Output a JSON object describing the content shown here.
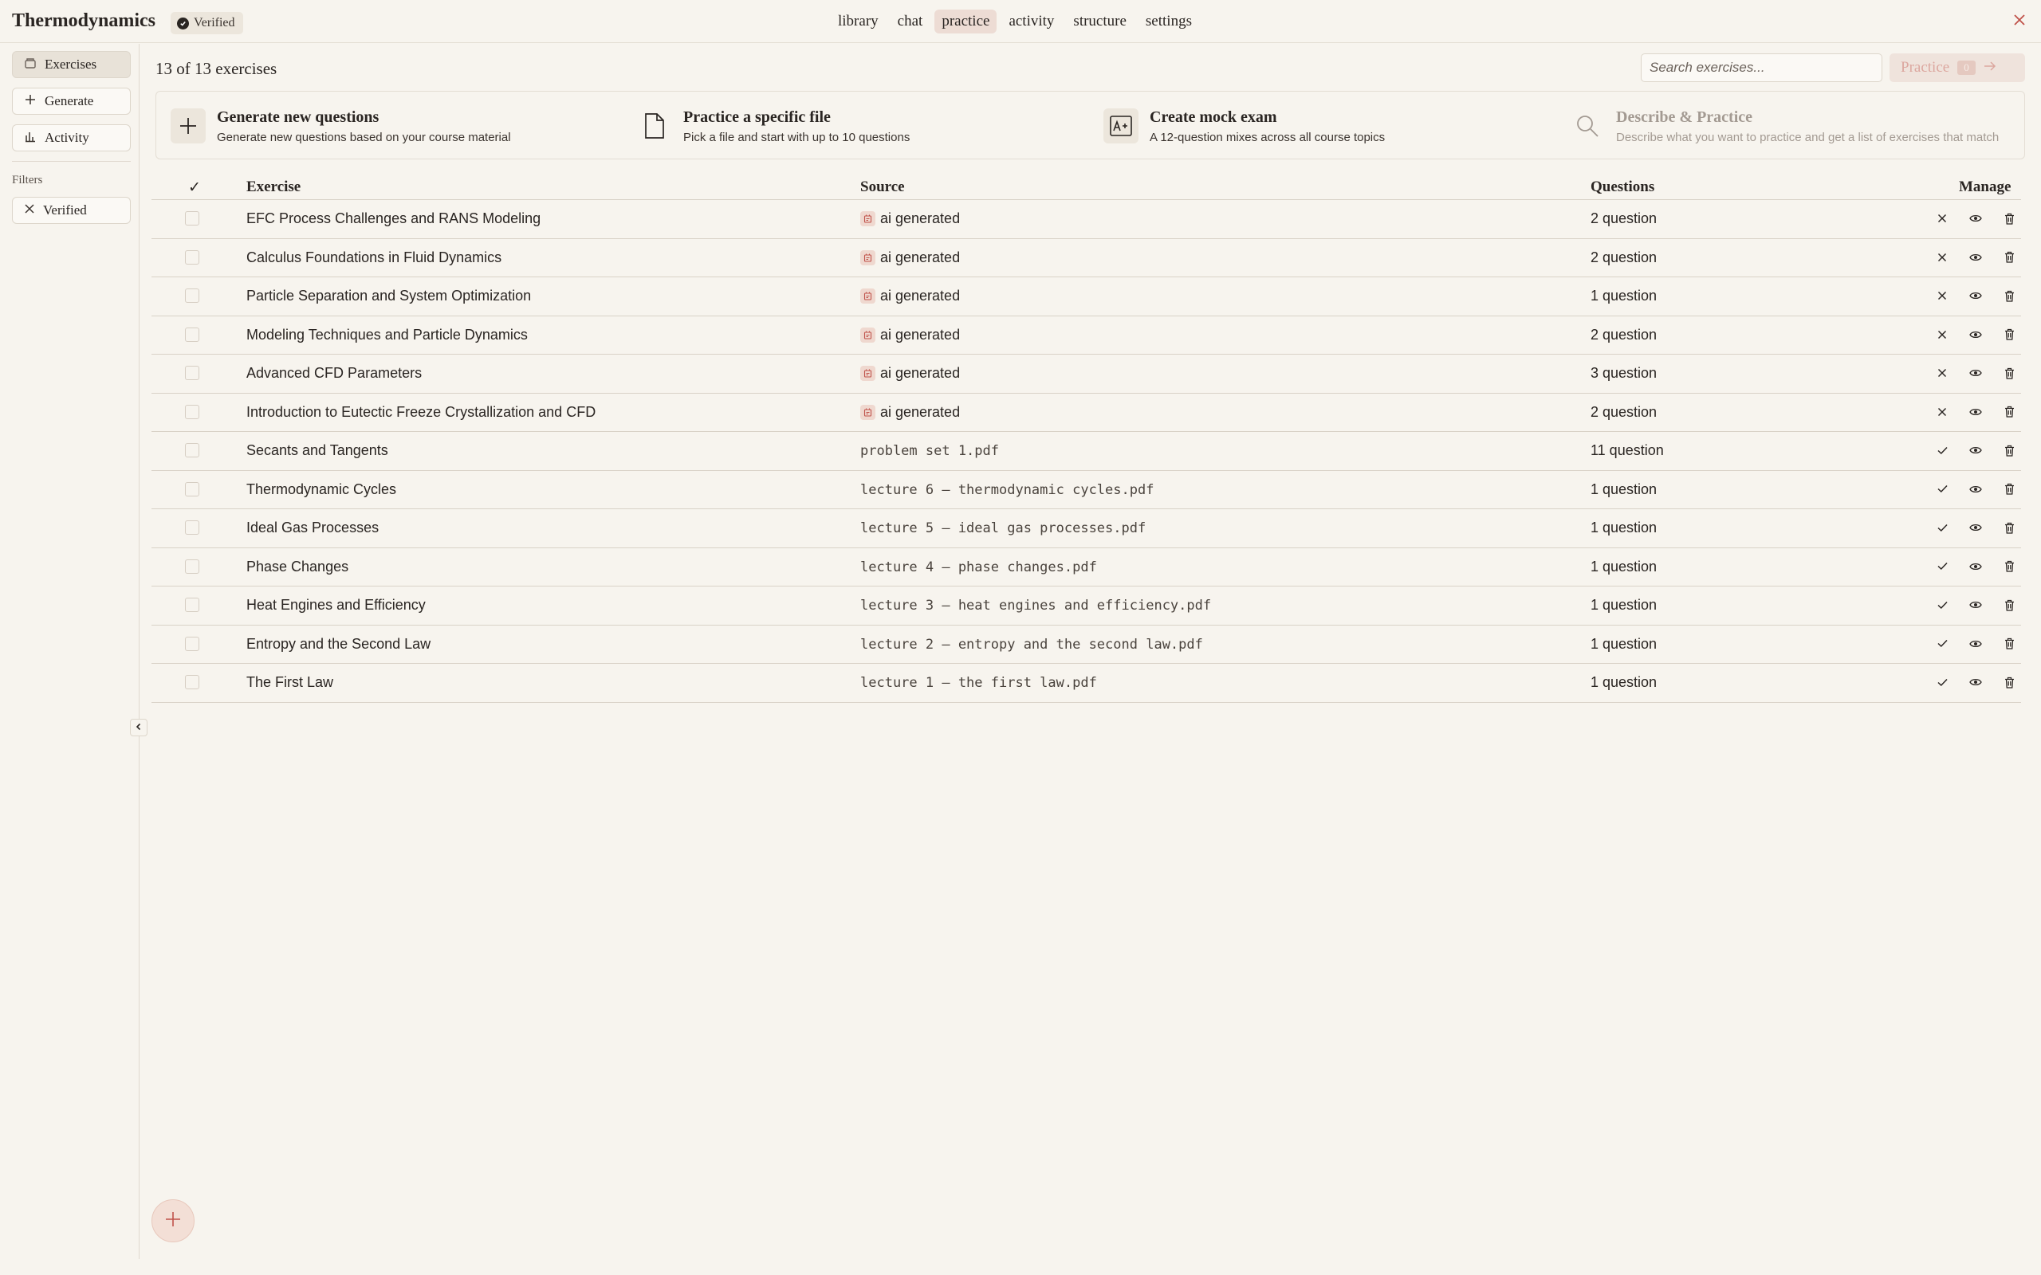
{
  "app": {
    "title": "Thermodynamics",
    "badge": "Verified"
  },
  "nav": {
    "tabs": [
      {
        "label": "library"
      },
      {
        "label": "chat"
      },
      {
        "label": "practice",
        "active": true
      },
      {
        "label": "activity"
      },
      {
        "label": "structure"
      },
      {
        "label": "settings"
      }
    ]
  },
  "sidebar": {
    "items": [
      {
        "label": "Exercises",
        "icon": "box-icon",
        "active": true
      },
      {
        "label": "Generate",
        "icon": "plus-icon"
      },
      {
        "label": "Activity",
        "icon": "bar-chart-icon"
      }
    ],
    "filters_label": "Filters",
    "filter_chip": "Verified"
  },
  "main": {
    "count_text": "13 of 13 exercises",
    "search_placeholder": "Search exercises...",
    "practice_label": "Practice",
    "practice_count": "0"
  },
  "actions": [
    {
      "title": "Generate new questions",
      "desc": "Generate new questions based on your course material",
      "icon": "plus-icon"
    },
    {
      "title": "Practice a specific file",
      "desc": "Pick a file and start with up to 10 questions",
      "icon": "file-icon"
    },
    {
      "title": "Create mock exam",
      "desc": "A 12-question mixes across all course topics",
      "icon": "exam-icon"
    },
    {
      "title": "Describe & Practice",
      "desc": "Describe what you want to practice and get a list of exercises that match",
      "icon": "search-icon",
      "disabled": true
    }
  ],
  "table": {
    "check_header": "✓",
    "headers": {
      "exercise": "Exercise",
      "source": "Source",
      "questions": "Questions",
      "manage": "Manage"
    },
    "rows": [
      {
        "exercise": "EFC Process Challenges and RANS Modeling",
        "source": "ai generated",
        "ai": true,
        "questions": "2 question",
        "verified": false
      },
      {
        "exercise": "Calculus Foundations in Fluid Dynamics",
        "source": "ai generated",
        "ai": true,
        "questions": "2 question",
        "verified": false
      },
      {
        "exercise": "Particle Separation and System Optimization",
        "source": "ai generated",
        "ai": true,
        "questions": "1 question",
        "verified": false
      },
      {
        "exercise": "Modeling Techniques and Particle Dynamics",
        "source": "ai generated",
        "ai": true,
        "questions": "2 question",
        "verified": false
      },
      {
        "exercise": "Advanced CFD Parameters",
        "source": "ai generated",
        "ai": true,
        "questions": "3 question",
        "verified": false
      },
      {
        "exercise": "Introduction to Eutectic Freeze Crystallization and CFD",
        "source": "ai generated",
        "ai": true,
        "questions": "2 question",
        "verified": false
      },
      {
        "exercise": "Secants and Tangents",
        "source": "problem set 1.pdf",
        "ai": false,
        "questions": "11 question",
        "verified": true
      },
      {
        "exercise": "Thermodynamic Cycles",
        "source": "lecture 6 — thermodynamic cycles.pdf",
        "ai": false,
        "questions": "1 question",
        "verified": true
      },
      {
        "exercise": "Ideal Gas Processes",
        "source": "lecture 5 — ideal gas processes.pdf",
        "ai": false,
        "questions": "1 question",
        "verified": true
      },
      {
        "exercise": "Phase Changes",
        "source": "lecture 4 — phase changes.pdf",
        "ai": false,
        "questions": "1 question",
        "verified": true
      },
      {
        "exercise": "Heat Engines and Efficiency",
        "source": "lecture 3 — heat engines and efficiency.pdf",
        "ai": false,
        "questions": "1 question",
        "verified": true
      },
      {
        "exercise": "Entropy and the Second Law",
        "source": "lecture 2 — entropy and the second law.pdf",
        "ai": false,
        "questions": "1 question",
        "verified": true
      },
      {
        "exercise": "The First Law",
        "source": "lecture 1 — the first law.pdf",
        "ai": false,
        "questions": "1 question",
        "verified": true
      }
    ]
  },
  "colors": {
    "background": "#f7f4ee",
    "accent": "#c0524a",
    "accent_light": "#eddcd4"
  }
}
